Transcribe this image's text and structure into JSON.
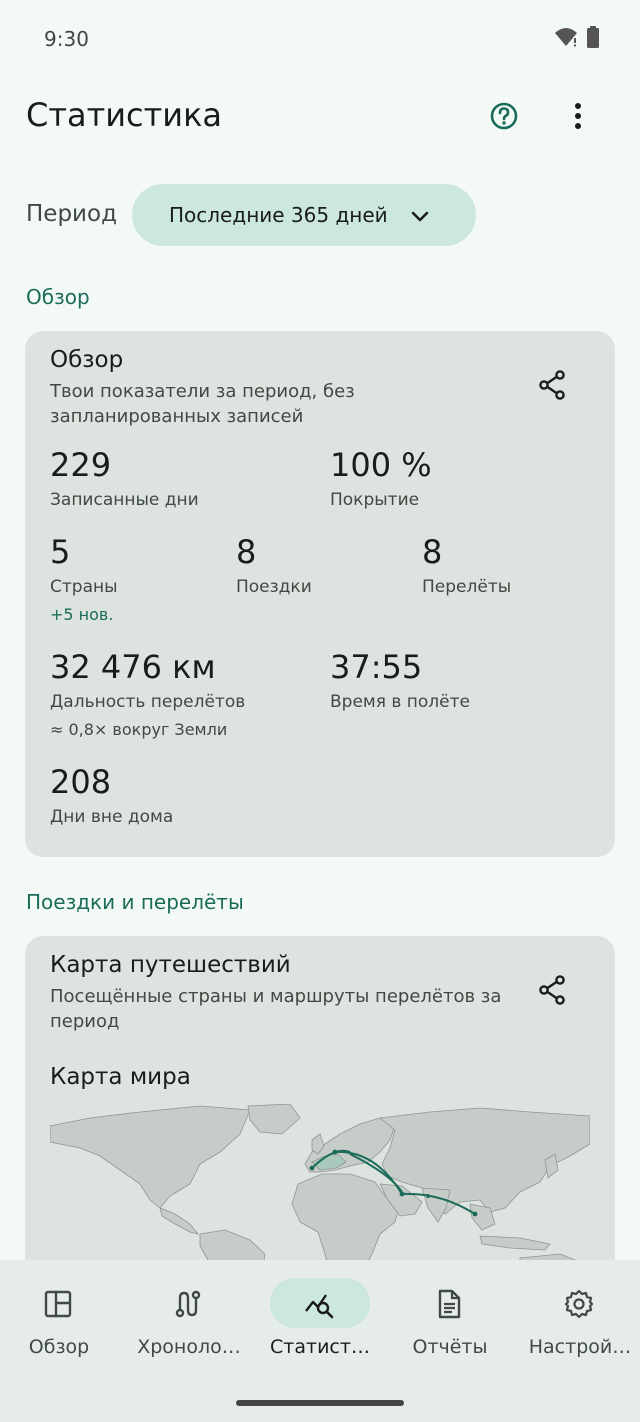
{
  "status_bar": {
    "time": "9:30",
    "icons": [
      "wifi-icon",
      "battery-icon"
    ]
  },
  "app_bar": {
    "title": "Статистика",
    "actions": [
      "help-icon",
      "more-vert-icon"
    ]
  },
  "period": {
    "label": "Период",
    "selected": "Последние 365 дней"
  },
  "sections": {
    "overview_header": "Обзор",
    "trips_header": "Поездки и перелёты"
  },
  "overview_card": {
    "title": "Обзор",
    "subtitle": "Твои показатели за период, без запланированных записей",
    "stats": {
      "recorded_days": {
        "value": "229",
        "label": "Записанные дни"
      },
      "coverage": {
        "value": "100 %",
        "label": "Покрытие"
      },
      "countries": {
        "value": "5",
        "label": "Страны",
        "note": "+5 нов."
      },
      "trips": {
        "value": "8",
        "label": "Поездки"
      },
      "flights": {
        "value": "8",
        "label": "Перелёты"
      },
      "flight_distance": {
        "value": "32 476 км",
        "label": "Дальность перелётов",
        "note": "≈ 0,8× вокруг Земли"
      },
      "flight_time": {
        "value": "37:55",
        "label": "Время в полёте"
      },
      "days_away": {
        "value": "208",
        "label": "Дни вне дома"
      }
    }
  },
  "travel_map_card": {
    "title": "Карта путешествий",
    "subtitle": "Посещённые страны и маршруты перелётов за период",
    "map_title": "Карта мира"
  },
  "bottom_nav": {
    "items": [
      {
        "label": "Обзор",
        "icon": "dashboard-icon",
        "active": false
      },
      {
        "label": "Хроноло…",
        "icon": "route-icon",
        "active": false
      },
      {
        "label": "Статист…",
        "icon": "query-stats-icon",
        "active": true
      },
      {
        "label": "Отчёты",
        "icon": "document-icon",
        "active": false
      },
      {
        "label": "Настрой…",
        "icon": "settings-icon",
        "active": false
      }
    ]
  },
  "colors": {
    "background": "#f3faf6",
    "accent": "#1b6b5a",
    "card": "#dde3df",
    "chip": "#cce8dd",
    "route": "#1b6b5a"
  }
}
